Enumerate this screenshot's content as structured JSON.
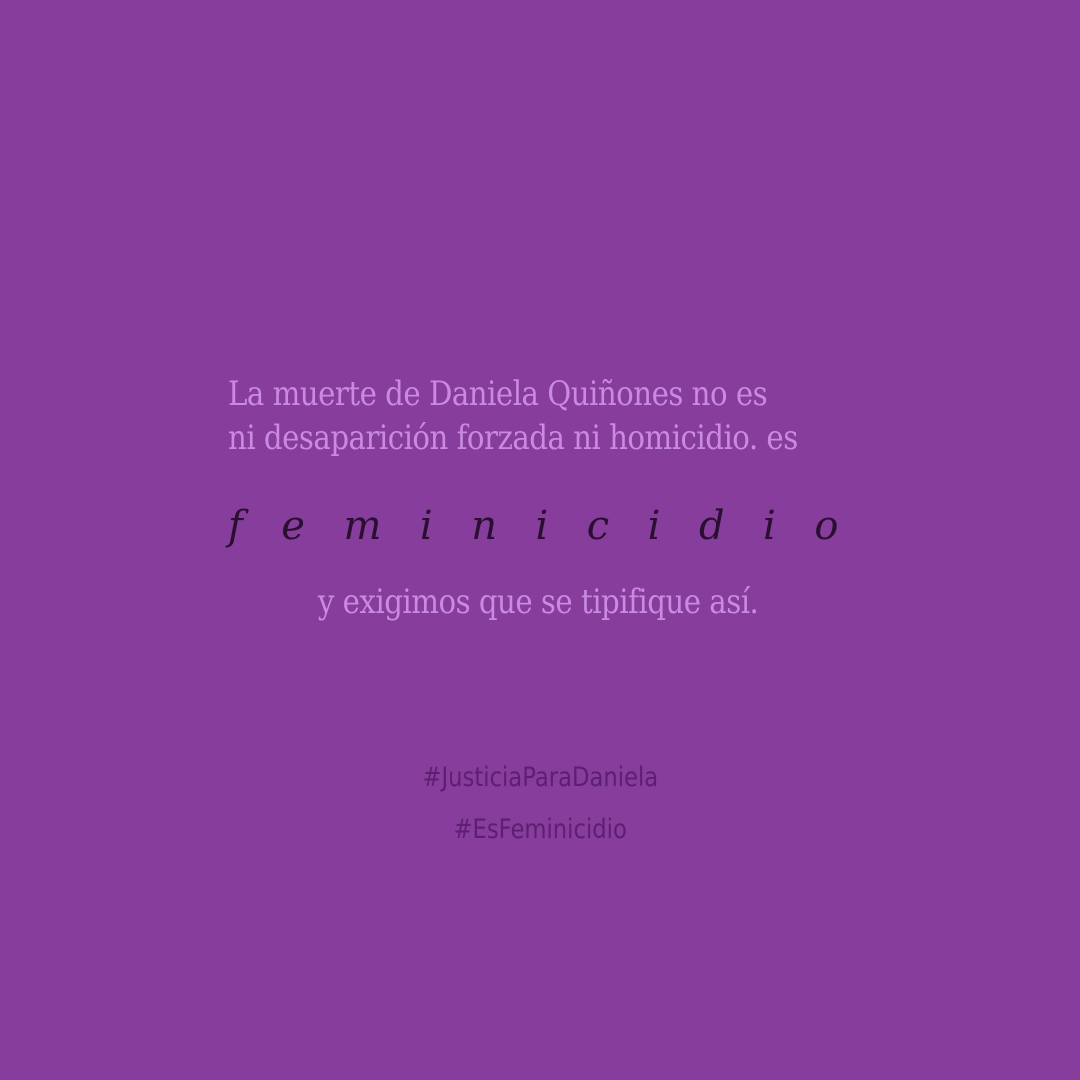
{
  "post": {
    "background_color": "#873d9c",
    "text_color": "#c98ae0",
    "script_color": "#2a0f33",
    "hashtag_color": "#5d1f72",
    "statement_line_1": "La muerte de Daniela Quiñones no es",
    "statement_line_2": "ni desaparición forzada ni homicidio. es",
    "emphasis_word": "feminicidio",
    "closing_line": "y exigimos que se tipifique así.",
    "hashtags": [
      "#JusticiaParaDaniela",
      "#EsFeminicidio"
    ]
  }
}
